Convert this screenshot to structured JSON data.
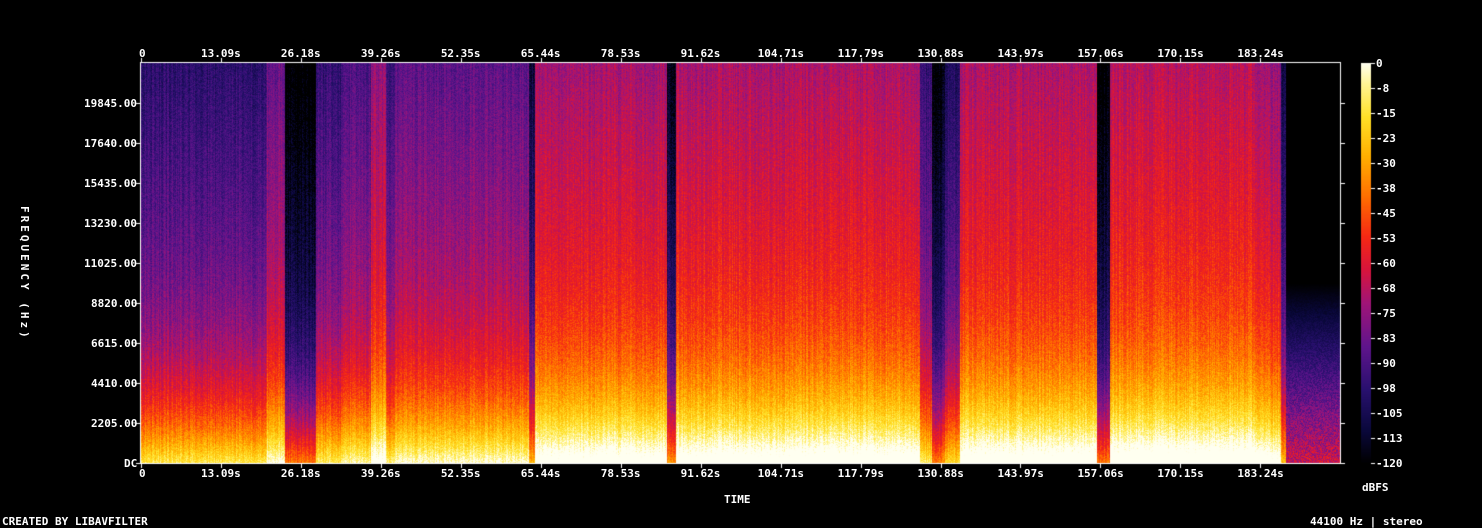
{
  "chart_data": {
    "type": "heatmap",
    "xlabel": "TIME",
    "ylabel": "FREQUENCY (Hz)",
    "x_ticks": [
      "0",
      "13.09s",
      "26.18s",
      "39.26s",
      "52.35s",
      "65.44s",
      "78.53s",
      "91.62s",
      "104.71s",
      "117.79s",
      "130.88s",
      "143.97s",
      "157.06s",
      "170.15s",
      "183.24s"
    ],
    "y_ticks": [
      "DC",
      "2205.00",
      "4410.00",
      "6615.00",
      "8820.00",
      "11025.00",
      "13230.00",
      "15435.00",
      "17640.00",
      "19845.00"
    ],
    "x_range": [
      0,
      196.3
    ],
    "y_range": [
      0,
      22050
    ],
    "colorbar": {
      "unit": "dBFS",
      "ticks": [
        "0",
        "-8",
        "-15",
        "-23",
        "-30",
        "-38",
        "-45",
        "-53",
        "-60",
        "-68",
        "-75",
        "-83",
        "-90",
        "-98",
        "-105",
        "-113",
        "-120"
      ],
      "range": [
        -120,
        0
      ]
    },
    "segments": [
      {
        "start": 0,
        "end": 20.5,
        "level_db": -88
      },
      {
        "start": 20.5,
        "end": 23.5,
        "level_db": -74
      },
      {
        "start": 23.5,
        "end": 28.5,
        "level_db": -114
      },
      {
        "start": 28.5,
        "end": 33.0,
        "level_db": -86
      },
      {
        "start": 33.0,
        "end": 37.5,
        "level_db": -80
      },
      {
        "start": 37.5,
        "end": 40.0,
        "level_db": -66
      },
      {
        "start": 40.0,
        "end": 41.5,
        "level_db": -84
      },
      {
        "start": 41.5,
        "end": 63.5,
        "level_db": -76
      },
      {
        "start": 63.5,
        "end": 64.5,
        "level_db": -100
      },
      {
        "start": 64.5,
        "end": 86.0,
        "level_db": -62
      },
      {
        "start": 86.0,
        "end": 87.5,
        "level_db": -106
      },
      {
        "start": 87.5,
        "end": 127.5,
        "level_db": -60
      },
      {
        "start": 127.5,
        "end": 129.5,
        "level_db": -86
      },
      {
        "start": 129.5,
        "end": 131.5,
        "level_db": -110
      },
      {
        "start": 131.5,
        "end": 134.0,
        "level_db": -92
      },
      {
        "start": 134.0,
        "end": 156.5,
        "level_db": -60
      },
      {
        "start": 156.5,
        "end": 158.5,
        "level_db": -112
      },
      {
        "start": 158.5,
        "end": 182.5,
        "level_db": -58
      },
      {
        "start": 182.5,
        "end": 186.5,
        "level_db": -64
      },
      {
        "start": 186.5,
        "end": 187.3,
        "level_db": -100
      },
      {
        "start": 187.3,
        "end": 196.3,
        "level_db": -120
      }
    ],
    "legend": "right"
  },
  "footer": {
    "left": "CREATED BY LIBAVFILTER",
    "right": "44100 Hz | stereo"
  }
}
